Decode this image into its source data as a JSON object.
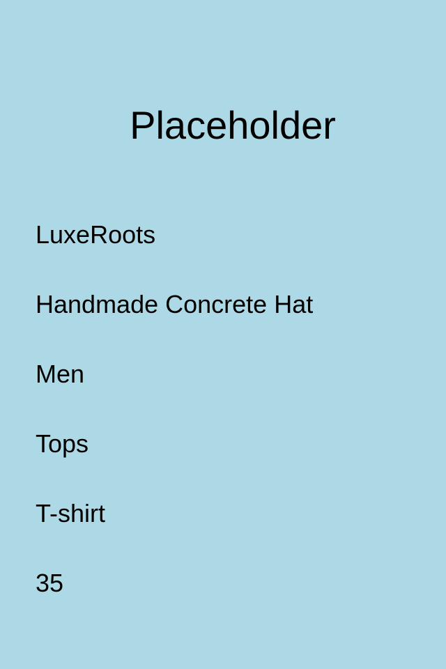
{
  "product": {
    "image_placeholder": "Placeholder",
    "brand": "LuxeRoots",
    "name": "Handmade Concrete Hat",
    "gender": "Men",
    "category": "Tops",
    "subcategory": "T-shirt",
    "price": "35"
  },
  "colors": {
    "background": "#add8e6",
    "text": "#000000"
  }
}
